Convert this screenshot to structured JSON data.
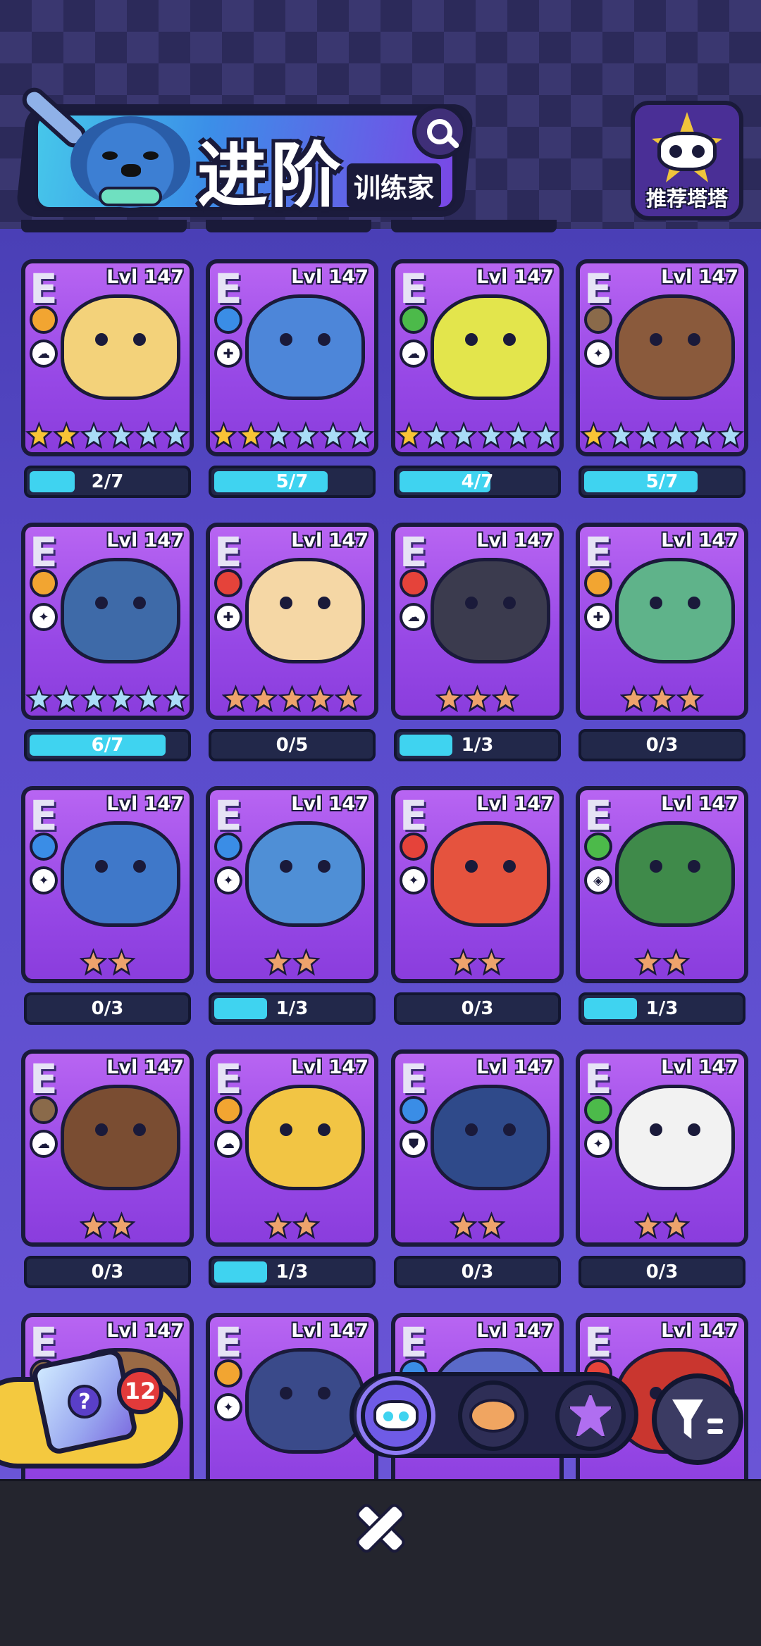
{
  "header": {
    "title": "进阶",
    "subtitle": "训练家",
    "recommend_label": "推荐塔塔"
  },
  "cards": [
    {
      "rarity": "E",
      "level": "Lvl 147",
      "element": "lightning",
      "role": "rogue",
      "color": "#f3d27a",
      "stars": [
        "gold",
        "gold",
        "blue",
        "blue",
        "blue",
        "blue"
      ],
      "progress": "2/7",
      "fill": 0.2857
    },
    {
      "rarity": "E",
      "level": "Lvl 147",
      "element": "water",
      "role": "healer",
      "color": "#4d86d9",
      "stars": [
        "gold",
        "gold",
        "blue",
        "blue",
        "blue",
        "blue"
      ],
      "progress": "5/7",
      "fill": 0.7143
    },
    {
      "rarity": "E",
      "level": "Lvl 147",
      "element": "nature",
      "role": "rogue",
      "color": "#e3e54c",
      "stars": [
        "gold",
        "blue",
        "blue",
        "blue",
        "blue",
        "blue"
      ],
      "progress": "4/7",
      "fill": 0.5714
    },
    {
      "rarity": "E",
      "level": "Lvl 147",
      "element": "earth",
      "role": "fighter",
      "color": "#8a5a3c",
      "stars": [
        "gold",
        "blue",
        "blue",
        "blue",
        "blue",
        "blue"
      ],
      "progress": "5/7",
      "fill": 0.7143
    },
    {
      "rarity": "E",
      "level": "Lvl 147",
      "element": "lightning",
      "role": "fighter",
      "color": "#3e6aa8",
      "stars": [
        "blue",
        "blue",
        "blue",
        "blue",
        "blue",
        "blue"
      ],
      "progress": "6/7",
      "fill": 0.8571
    },
    {
      "rarity": "E",
      "level": "Lvl 147",
      "element": "fire",
      "role": "healer",
      "color": "#f5d7a5",
      "stars": [
        "orange",
        "orange",
        "orange",
        "orange",
        "orange"
      ],
      "progress": "0/5",
      "fill": 0
    },
    {
      "rarity": "E",
      "level": "Lvl 147",
      "element": "fire",
      "role": "rogue",
      "color": "#3b3b4e",
      "stars": [
        "orange",
        "orange",
        "orange"
      ],
      "progress": "1/3",
      "fill": 0.3333
    },
    {
      "rarity": "E",
      "level": "Lvl 147",
      "element": "lightning",
      "role": "healer",
      "color": "#5fb38a",
      "stars": [
        "orange",
        "orange",
        "orange"
      ],
      "progress": "0/3",
      "fill": 0
    },
    {
      "rarity": "E",
      "level": "Lvl 147",
      "element": "water",
      "role": "fighter",
      "color": "#3f78c9",
      "stars": [
        "orange",
        "orange"
      ],
      "progress": "0/3",
      "fill": 0
    },
    {
      "rarity": "E",
      "level": "Lvl 147",
      "element": "water",
      "role": "fighter",
      "color": "#4f8fd6",
      "stars": [
        "orange",
        "orange"
      ],
      "progress": "1/3",
      "fill": 0.3333
    },
    {
      "rarity": "E",
      "level": "Lvl 147",
      "element": "fire",
      "role": "fighter",
      "color": "#e5533e",
      "stars": [
        "orange",
        "orange"
      ],
      "progress": "0/3",
      "fill": 0
    },
    {
      "rarity": "E",
      "level": "Lvl 147",
      "element": "nature",
      "role": "mage",
      "color": "#3f8a4a",
      "stars": [
        "orange",
        "orange"
      ],
      "progress": "1/3",
      "fill": 0.3333
    },
    {
      "rarity": "E",
      "level": "Lvl 147",
      "element": "earth",
      "role": "rogue",
      "color": "#7a4d32",
      "stars": [
        "orange",
        "orange"
      ],
      "progress": "0/3",
      "fill": 0
    },
    {
      "rarity": "E",
      "level": "Lvl 147",
      "element": "lightning",
      "role": "rogue",
      "color": "#f2c544",
      "stars": [
        "orange",
        "orange"
      ],
      "progress": "1/3",
      "fill": 0.3333
    },
    {
      "rarity": "E",
      "level": "Lvl 147",
      "element": "water",
      "role": "tank",
      "color": "#2f4a8a",
      "stars": [
        "orange",
        "orange"
      ],
      "progress": "0/3",
      "fill": 0
    },
    {
      "rarity": "E",
      "level": "Lvl 147",
      "element": "nature",
      "role": "fighter",
      "color": "#f2f2f2",
      "stars": [
        "orange",
        "orange"
      ],
      "progress": "0/3",
      "fill": 0
    },
    {
      "rarity": "E",
      "level": "Lvl 147",
      "element": "earth",
      "role": "rogue",
      "color": "#9a6a45",
      "stars": [],
      "progress": "",
      "fill": 0
    },
    {
      "rarity": "E",
      "level": "Lvl 147",
      "element": "lightning",
      "role": "fighter",
      "color": "#3a4a8a",
      "stars": [],
      "progress": "",
      "fill": 0
    },
    {
      "rarity": "E",
      "level": "Lvl 147",
      "element": "water",
      "role": "tank",
      "color": "#5a6ac9",
      "stars": [],
      "progress": "",
      "fill": 0
    },
    {
      "rarity": "E",
      "level": "Lvl 147",
      "element": "fire",
      "role": "fighter",
      "color": "#c9362f",
      "stars": [],
      "progress": "",
      "fill": 0
    }
  ],
  "element_colors": {
    "lightning": "#f2a531",
    "water": "#3a8de6",
    "nature": "#4cba4a",
    "earth": "#8a6a4a",
    "fire": "#e5433a"
  },
  "role_glyphs": {
    "rogue": "☁",
    "healer": "✚",
    "fighter": "✦",
    "tank": "⛊",
    "mage": "◈"
  },
  "loot": {
    "badge_count": "12",
    "icon": "mystery-box-icon"
  },
  "filters": [
    {
      "name": "filter-tab-cat",
      "icon": "cat-face-icon",
      "active": true
    },
    {
      "name": "filter-tab-bun",
      "icon": "bun-icon",
      "active": false
    },
    {
      "name": "filter-tab-gem",
      "icon": "star-gem-icon",
      "active": false
    }
  ],
  "sort_icon": "funnel-sort-icon",
  "close_icon": "close-icon"
}
